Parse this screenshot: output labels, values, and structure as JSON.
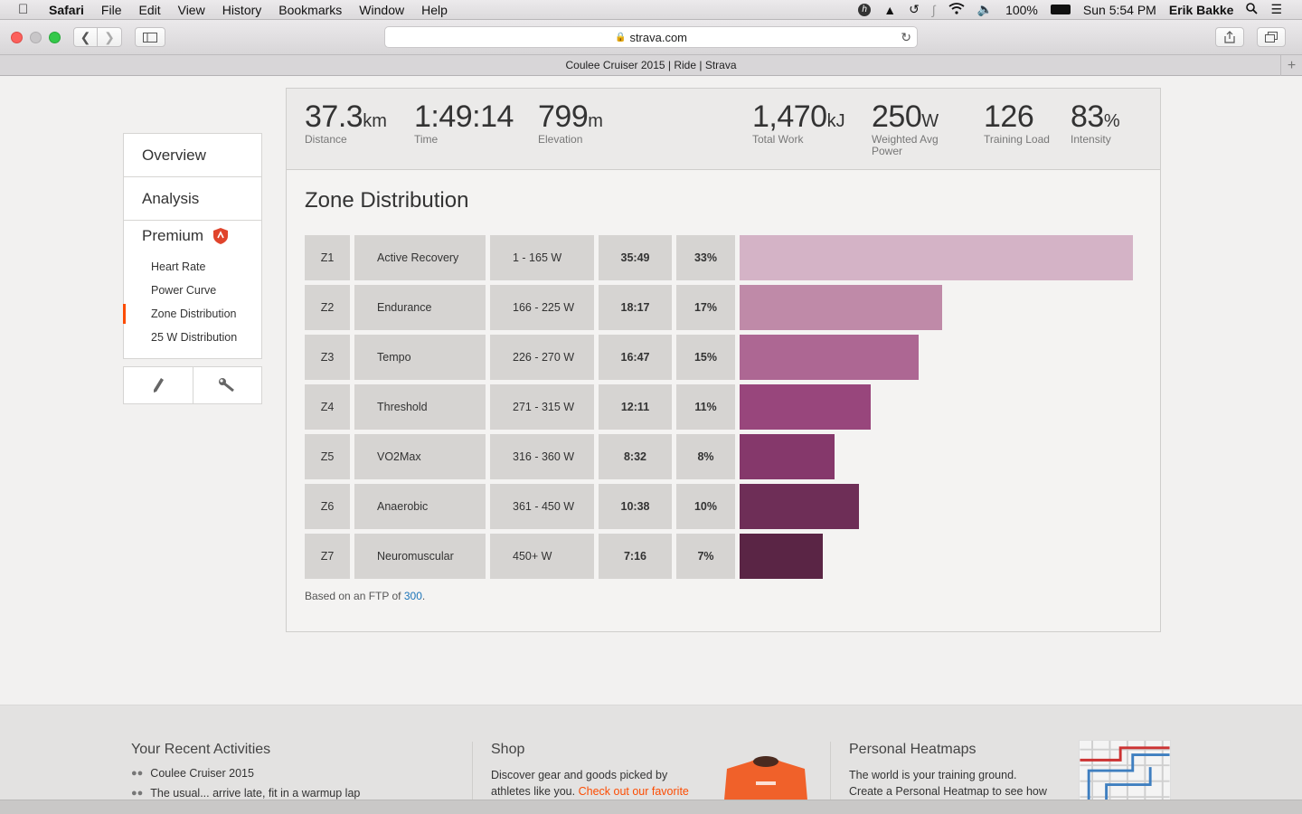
{
  "menubar": {
    "app": "Safari",
    "items": [
      "File",
      "Edit",
      "View",
      "History",
      "Bookmarks",
      "Window",
      "Help"
    ],
    "battery": "100%",
    "clock": "Sun 5:54 PM",
    "user": "Erik Bakke"
  },
  "browser": {
    "url": "strava.com",
    "tab_title": "Coulee Cruiser 2015 | Ride | Strava"
  },
  "nav": {
    "overview": "Overview",
    "analysis": "Analysis",
    "premium": "Premium",
    "sub": [
      "Heart Rate",
      "Power Curve",
      "Zone Distribution",
      "25 W Distribution"
    ]
  },
  "stats": {
    "distance": {
      "value": "37.3",
      "unit": "km",
      "label": "Distance"
    },
    "time": {
      "value": "1:49:14",
      "label": "Time"
    },
    "elevation": {
      "value": "799",
      "unit": "m",
      "label": "Elevation"
    },
    "work": {
      "value": "1,470",
      "unit": "kJ",
      "label": "Total Work"
    },
    "power": {
      "value": "250",
      "unit": "W",
      "label_1": "Weighted Avg",
      "label_2": "Power"
    },
    "load": {
      "value": "126",
      "label": "Training Load"
    },
    "intensity": {
      "value": "83",
      "unit": "%",
      "label": "Intensity"
    }
  },
  "zone_distribution": {
    "title": "Zone Distribution",
    "zones": [
      {
        "id": "Z1",
        "name": "Active Recovery",
        "range": "1 - 165 W",
        "time": "35:49",
        "pct": "33%",
        "fraction": 0.33,
        "color": "#d4b3c6"
      },
      {
        "id": "Z2",
        "name": "Endurance",
        "range": "166 - 225 W",
        "time": "18:17",
        "pct": "17%",
        "fraction": 0.17,
        "color": "#bf8aa8"
      },
      {
        "id": "Z3",
        "name": "Tempo",
        "range": "226 - 270 W",
        "time": "16:47",
        "pct": "15%",
        "fraction": 0.15,
        "color": "#ad6793"
      },
      {
        "id": "Z4",
        "name": "Threshold",
        "range": "271 - 315 W",
        "time": "12:11",
        "pct": "11%",
        "fraction": 0.11,
        "color": "#98467c"
      },
      {
        "id": "Z5",
        "name": "VO2Max",
        "range": "316 - 360 W",
        "time": "8:32",
        "pct": "8%",
        "fraction": 0.08,
        "color": "#85386b"
      },
      {
        "id": "Z6",
        "name": "Anaerobic",
        "range": "361 - 450 W",
        "time": "10:38",
        "pct": "10%",
        "fraction": 0.1,
        "color": "#6e2e57"
      },
      {
        "id": "Z7",
        "name": "Neuromuscular",
        "range": "450+ W",
        "time": "7:16",
        "pct": "7%",
        "fraction": 0.07,
        "color": "#5a2545"
      }
    ],
    "ftp_prefix": "Based on an FTP of",
    "ftp_value": "300",
    "ftp_suffix": "."
  },
  "footer": {
    "recent": {
      "title": "Your Recent Activities",
      "item_1": "Coulee Cruiser 2015",
      "item_2": "The usual... arrive late, fit in a warmup lap"
    },
    "shop": {
      "title": "Shop",
      "line_1": "Discover gear and goods picked by",
      "line_2_a": "athletes like you.",
      "line_2_b": "Check out our favorite"
    },
    "heatmaps": {
      "title": "Personal Heatmaps",
      "line_1": "The world is your training ground.",
      "line_2": "Create a Personal Heatmap to see how"
    }
  },
  "colors": {
    "strava_orange": "#fc4c02",
    "link_blue": "#1b74b8"
  }
}
